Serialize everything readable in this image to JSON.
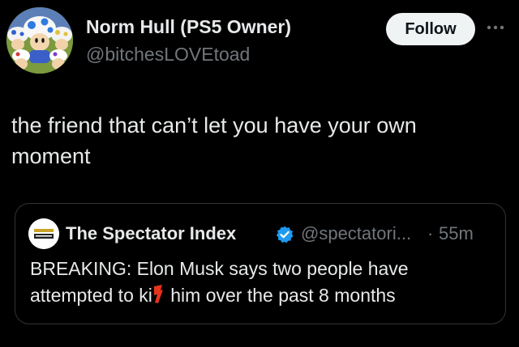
{
  "author": {
    "display_name": "Norm Hull (PS5 Owner)",
    "handle": "@bitchesLOVEtoad",
    "avatar_icon": "toad-group-avatar"
  },
  "actions": {
    "follow_label": "Follow",
    "more_icon": "more-horizontal-icon"
  },
  "post": {
    "text": "the friend that can’t let you have your own moment"
  },
  "quote": {
    "author_name": "The Spectator Index",
    "verified": true,
    "handle": "@spectatori...",
    "separator": "·",
    "time": "55m",
    "text_before": "BREAKING: Elon Musk says two people have attempted to ki",
    "text_after": " him over the past 8 months",
    "avatar_icon": "spectator-index-logo"
  },
  "colors": {
    "background": "#000000",
    "primary_text": "#e7e9ea",
    "secondary_text": "#71767b",
    "border": "#2f3336",
    "follow_bg": "#eff3f4",
    "verified_blue": "#1d9bf0",
    "redaction_mark": "#e5341c"
  }
}
